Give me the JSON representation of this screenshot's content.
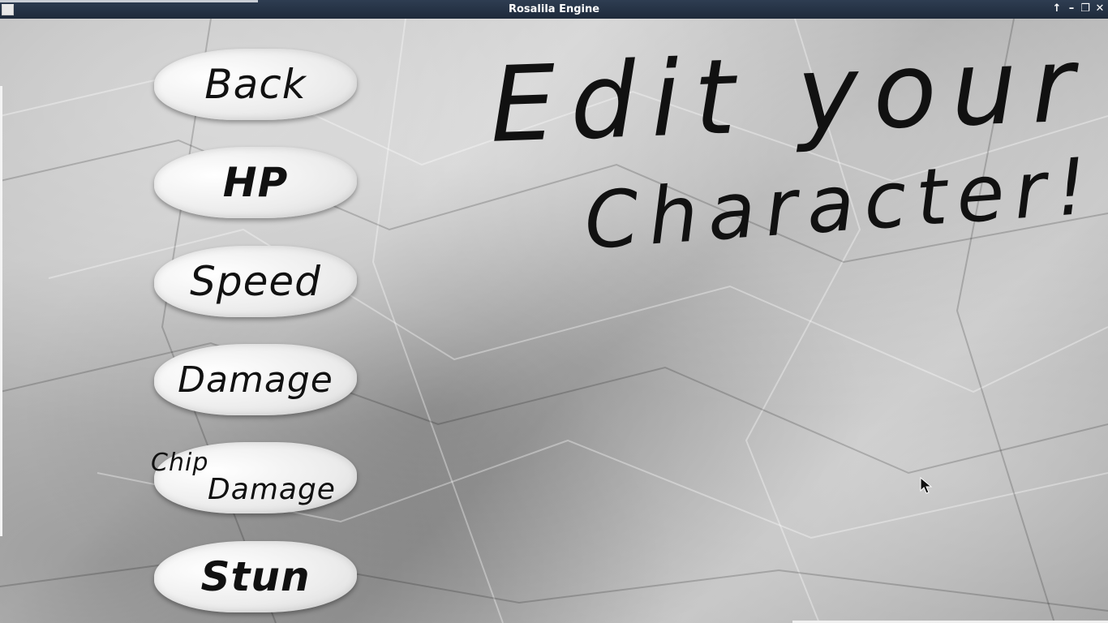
{
  "window": {
    "title": "Rosalila Engine",
    "controls": [
      "up-arrow-icon",
      "minimize-icon",
      "restore-icon",
      "close-icon"
    ]
  },
  "heading": {
    "line1": "Edit your",
    "line2": "Character!"
  },
  "menu": [
    {
      "label": "Back"
    },
    {
      "label": "HP"
    },
    {
      "label": "Speed"
    },
    {
      "label": "Damage"
    },
    {
      "label_line1": "Chip",
      "label_line2": "Damage"
    },
    {
      "label": "Stun"
    }
  ],
  "colors": {
    "titlebar": "#1e2a3a",
    "paper": "#bdbdbd",
    "ink": "#111111"
  }
}
